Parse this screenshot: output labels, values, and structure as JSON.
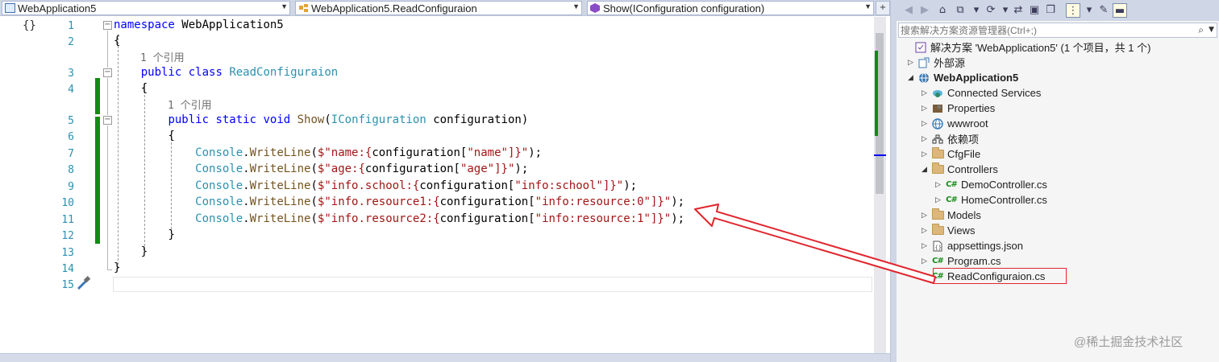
{
  "navbar": {
    "project_dropdown": "WebApplication5",
    "class_dropdown": "WebApplication5.ReadConfiguraion",
    "member_dropdown": "Show(IConfiguration configuration)"
  },
  "editor": {
    "line_numbers": [
      "1",
      "2",
      "3",
      "4",
      "5",
      "6",
      "7",
      "8",
      "9",
      "10",
      "11",
      "12",
      "13",
      "14",
      "15"
    ],
    "codelens_ref": "1 个引用",
    "tokens": {
      "namespace": "namespace",
      "ns_name": "WebApplication5",
      "public": "public",
      "class": "class",
      "class_name": "ReadConfiguraion",
      "static": "static",
      "void": "void",
      "method": "Show",
      "param_type": "IConfiguration",
      "param_name": "configuration",
      "console": "Console",
      "writeline": "WriteLine",
      "indexer_obj": "configuration",
      "open_brace": "{",
      "close_brace": "}"
    },
    "writeline_lines": [
      {
        "prefix": "$\"name:{",
        "key": "\"name\"",
        "suffix": "]}\""
      },
      {
        "prefix": "$\"age:{",
        "key": "\"age\"",
        "suffix": "]}\""
      },
      {
        "prefix": "$\"info.school:{",
        "key": "\"info:school\"",
        "suffix": "]}\""
      },
      {
        "prefix": "$\"info.resource1:{",
        "key": "\"info:resource:0\"",
        "suffix": "]}\""
      },
      {
        "prefix": "$\"info.resource2:{",
        "key": "\"info:resource:1\"",
        "suffix": "]}\""
      }
    ]
  },
  "solution_explorer": {
    "search_placeholder": "搜索解决方案资源管理器(Ctrl+;)",
    "items": [
      {
        "label": "解决方案 'WebApplication5' (1 个项目，共 1 个)",
        "icon": "solution-icon"
      },
      {
        "label": "外部源",
        "icon": "external-sources-icon"
      },
      {
        "label": "WebApplication5",
        "icon": "web-project-icon"
      },
      {
        "label": "Connected Services",
        "icon": "connected-services-icon"
      },
      {
        "label": "Properties",
        "icon": "properties-icon"
      },
      {
        "label": "wwwroot",
        "icon": "globe-icon"
      },
      {
        "label": "依赖项",
        "icon": "dependencies-icon"
      },
      {
        "label": "CfgFile",
        "icon": "folder-icon"
      },
      {
        "label": "Controllers",
        "icon": "folder-icon"
      },
      {
        "label": "DemoController.cs",
        "icon": "csharp-file-icon"
      },
      {
        "label": "HomeController.cs",
        "icon": "csharp-file-icon"
      },
      {
        "label": "Models",
        "icon": "folder-icon"
      },
      {
        "label": "Views",
        "icon": "folder-icon"
      },
      {
        "label": "appsettings.json",
        "icon": "json-file-icon"
      },
      {
        "label": "Program.cs",
        "icon": "csharp-file-icon"
      },
      {
        "label": "ReadConfiguraion.cs",
        "icon": "csharp-file-icon"
      }
    ]
  },
  "watermark": "@稀土掘金技术社区",
  "colors": {
    "keyword": "#0000ff",
    "type": "#2b91af",
    "string": "#a31515",
    "annotation_red": "#e1252e",
    "change_margin": "#108c10"
  }
}
